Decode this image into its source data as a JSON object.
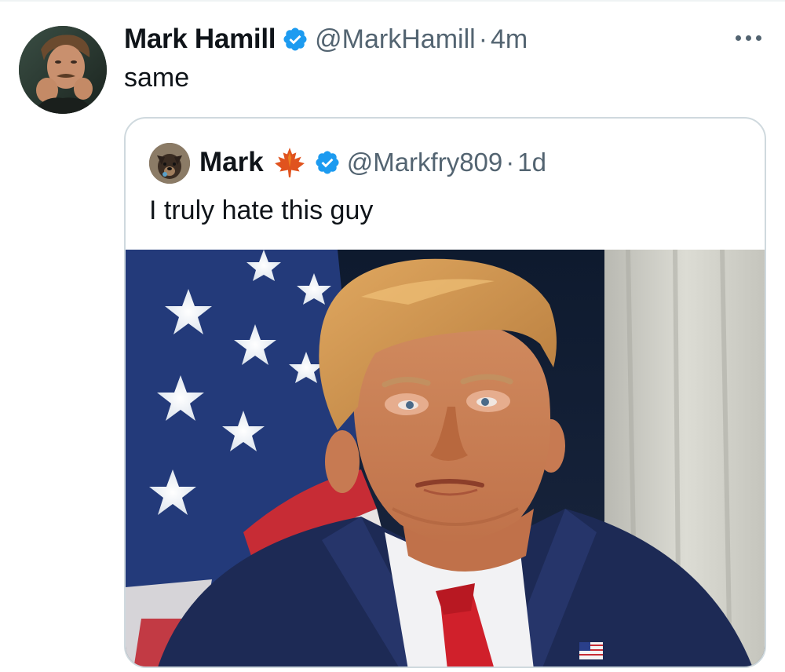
{
  "tweet": {
    "author": {
      "display_name": "Mark Hamill",
      "handle": "@MarkHamill",
      "verified": true
    },
    "separator": "·",
    "time": "4m",
    "text": "same",
    "more_icon": "more-horizontal-icon"
  },
  "quoted_tweet": {
    "author": {
      "display_name": "Mark",
      "flag_emoji": "maple-leaf-icon",
      "handle": "@Markfry809",
      "verified": true
    },
    "separator": "·",
    "time": "1d",
    "text": "I truly hate this guy",
    "media": {
      "type": "photo"
    }
  },
  "colors": {
    "text_primary": "#0f1419",
    "text_secondary": "#536471",
    "verified_blue": "#1d9bf0",
    "card_border": "#cfd9de"
  }
}
